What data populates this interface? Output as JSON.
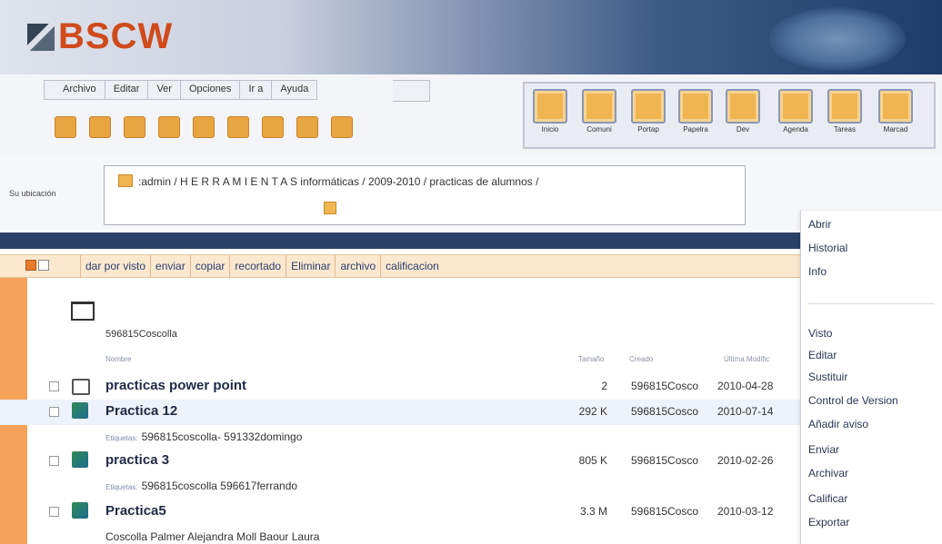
{
  "logo": {
    "text": "BSCW"
  },
  "menu": [
    "Archivo",
    "Editar",
    "Ver",
    "Opciones",
    "Ir a",
    "Ayuda"
  ],
  "toolbar_icons": [
    "new-icon",
    "forward-icon",
    "document-icon",
    "share-icon",
    "mail-icon",
    "folder-icon",
    "page-icon",
    "archive-icon",
    "link-icon"
  ],
  "app_buttons": [
    {
      "label": "Inicio",
      "icon": "home-icon"
    },
    {
      "label": "Comuni",
      "icon": "community-icon"
    },
    {
      "label": "Portap",
      "icon": "clipboard-icon"
    },
    {
      "label": "Papelra",
      "icon": "trash-icon"
    },
    {
      "label": "Dev",
      "icon": "bookmark-icon"
    },
    {
      "label": "Agenda",
      "icon": "calendar-icon"
    },
    {
      "label": "Tareas",
      "icon": "tasks-icon"
    },
    {
      "label": "Marcad",
      "icon": "map-icon"
    }
  ],
  "location": {
    "label": "Su ubicación",
    "path": ":admin / H E R R A M I E N T A S informáticas / 2009-2010 / practicas de alumnos /"
  },
  "actions": [
    "dar por visto",
    "enviar",
    "copiar",
    "recortado",
    "Eliminar",
    "archivo",
    "calificacion"
  ],
  "folder": {
    "owner": "596815Coscolla"
  },
  "columns": {
    "name": "Nombre",
    "size": "Tamaño",
    "creator": "Creado",
    "modified": "Última Modific"
  },
  "rows": [
    {
      "name": "practicas power point",
      "type": "folder",
      "size": "2",
      "creator": "596815Cosco",
      "date": "2010-04-28",
      "tags": ""
    },
    {
      "name": "Practica 12",
      "type": "ppt",
      "size": "292 K",
      "creator": "596815Cosco",
      "date": "2010-07-14",
      "tags": "596815coscolla- 591332domingo"
    },
    {
      "name": "practica 3",
      "type": "ppt",
      "size": "805 K",
      "creator": "596815Cosco",
      "date": "2010-02-26",
      "tags": "596815coscolla 596617ferrando"
    },
    {
      "name": "Practica5",
      "type": "ppt",
      "size": "3.3 M",
      "creator": "596815Cosco",
      "date": "2010-03-12",
      "tags": "Coscolla Palmer Alejandra Moll Baour Laura"
    }
  ],
  "tags_label": "Etiquetas:",
  "context_menu": {
    "group1": [
      "Abrir",
      "Historial",
      "Info"
    ],
    "group2": [
      "Visto",
      "Editar",
      "Sustituir",
      "Control de Version",
      "Añadir aviso",
      "Enviar",
      "Archivar",
      "Calificar",
      "Exportar"
    ]
  },
  "colors": {
    "accent": "#f5a35b",
    "header_dark": "#1e3c6a",
    "logo": "#d04a1c"
  }
}
